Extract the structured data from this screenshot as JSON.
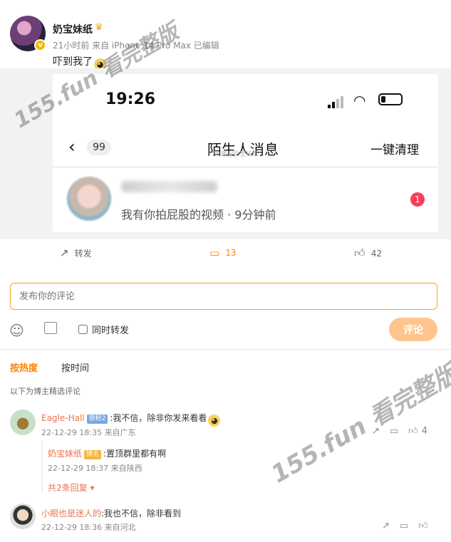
{
  "post": {
    "username": "奶宝妹纸",
    "verified_badge": "v",
    "meta": "21小时前 来自 iPhone 14 Pro Max 已编辑",
    "text": "吓到我了"
  },
  "screenshot": {
    "time": "19:26",
    "back_count": "99",
    "title": "陌生人消息",
    "clear_label": "一键清理",
    "message_text": "我有你拍屁股的视频 · 9分钟前",
    "unread_count": "1",
    "faint_label": "微博@奶宝妹纸"
  },
  "actions": {
    "repost_label": "转发",
    "comment_count": "13",
    "like_count": "42"
  },
  "composer": {
    "placeholder": "发布你的评论",
    "repost_checkbox_label": "同时转发",
    "submit_label": "评论"
  },
  "sort": {
    "hot_label": "按热度",
    "time_label": "按时间"
  },
  "comments_note": "以下为博主精选评论",
  "comments": [
    {
      "author": "Eagle-Hall",
      "tag": "铁粉2",
      "text": ":我不信，除非你发来看看",
      "meta": "22-12-29 18:35 来自广东",
      "like_count": "4",
      "reply": {
        "author": "奶宝妹纸",
        "tag": "博主",
        "text": ":置顶群里都有啊",
        "meta": "22-12-29 18:37 来自陕西"
      },
      "more_replies_label": "共2条回复"
    },
    {
      "author": "小眼也是迷人的",
      "text": ":我也不信，除非看到",
      "meta": "22-12-29 18:36 来自河北"
    }
  ],
  "watermark": {
    "text1": "155.fun 看完整版",
    "text2": "155.fun 看完整版"
  },
  "colors": {
    "accent": "#ff8200",
    "name": "#eb7350",
    "badge": "#ff3b5c",
    "submit": "#ffc58d"
  }
}
